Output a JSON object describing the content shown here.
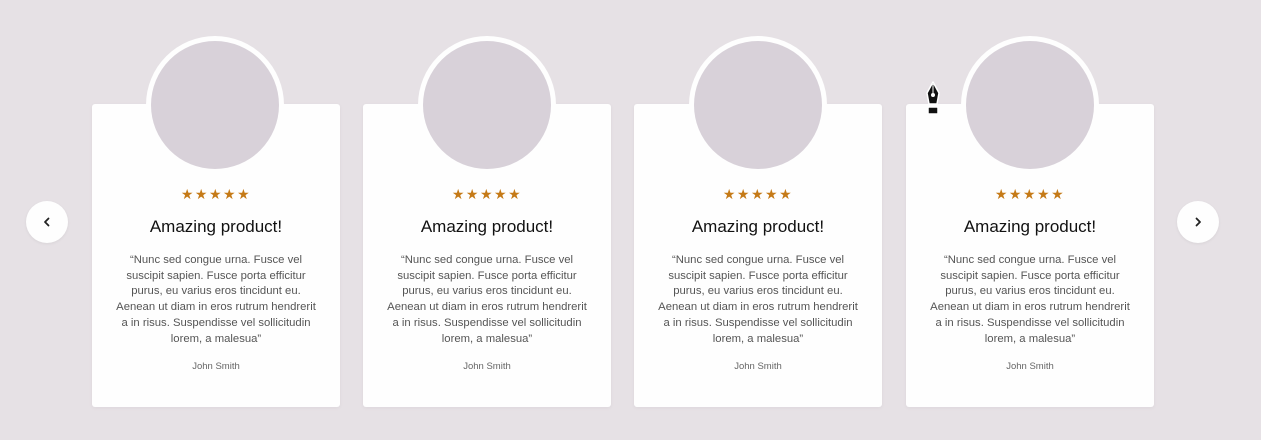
{
  "carousel": {
    "prev_icon": "chevron-left-icon",
    "next_icon": "chevron-right-icon",
    "cards": [
      {
        "stars": "★★★★★",
        "rating": 5,
        "title": "Amazing product!",
        "quote": "“Nunc sed congue urna. Fusce vel suscipit sapien. Fusce porta efficitur purus, eu varius eros tincidunt eu. Aenean ut diam in eros rutrum hendrerit a in risus. Suspendisse vel sollicitudin lorem, a malesua”",
        "author": "John Smith"
      },
      {
        "stars": "★★★★★",
        "rating": 5,
        "title": "Amazing product!",
        "quote": "“Nunc sed congue urna. Fusce vel suscipit sapien. Fusce porta efficitur purus, eu varius eros tincidunt eu. Aenean ut diam in eros rutrum hendrerit a in risus. Suspendisse vel sollicitudin lorem, a malesua”",
        "author": "John Smith"
      },
      {
        "stars": "★★★★★",
        "rating": 5,
        "title": "Amazing product!",
        "quote": "“Nunc sed congue urna. Fusce vel suscipit sapien. Fusce porta efficitur purus, eu varius eros tincidunt eu. Aenean ut diam in eros rutrum hendrerit a in risus. Suspendisse vel sollicitudin lorem, a malesua”",
        "author": "John Smith"
      },
      {
        "stars": "★★★★★",
        "rating": 5,
        "title": "Amazing product!",
        "quote": "“Nunc sed congue urna. Fusce vel suscipit sapien. Fusce porta efficitur purus, eu varius eros tincidunt eu. Aenean ut diam in eros rutrum hendrerit a in risus. Suspendisse vel sollicitudin lorem, a malesua”",
        "author": "John Smith"
      }
    ]
  },
  "cursor": {
    "icon": "pen-tool-cursor-icon"
  },
  "colors": {
    "background": "#e6e1e5",
    "card": "#fefefe",
    "avatar_placeholder": "#d8d1d9",
    "star": "#c57a17"
  }
}
